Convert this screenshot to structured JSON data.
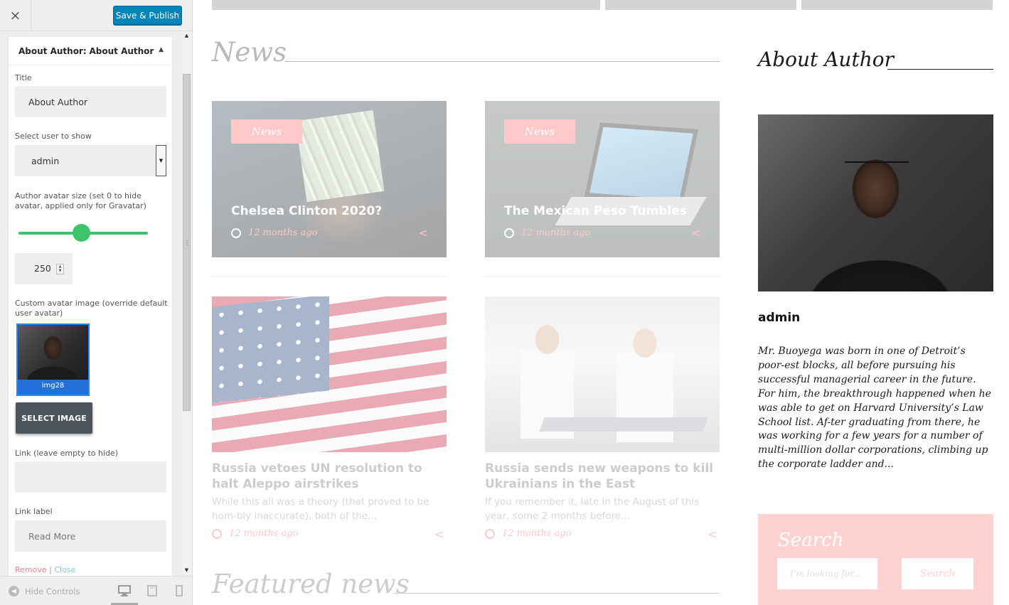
{
  "header": {
    "close_icon": "×",
    "save_label": "Save & Publish"
  },
  "widget": {
    "title_prefix": "About Author:",
    "title_instance": "About Author",
    "toggle_icon": "▲",
    "fields": {
      "title_label": "Title",
      "title_value": "About Author",
      "user_label": "Select user to show",
      "user_value": "admin",
      "avatar_size_label": "Author avatar size (set 0 to hide avatar, applied only for Gravatar)",
      "avatar_size_value": "250",
      "custom_avatar_label": "Custom avatar image (override default user avatar)",
      "avatar_file_name": "img28",
      "select_image_label": "SELECT IMAGE",
      "link_label": "Link (leave empty to hide)",
      "link_value": "",
      "link_label_label": "Link label",
      "link_label_value": "Read More"
    },
    "actions": {
      "remove": "Remove",
      "separator": "|",
      "close": "Close"
    }
  },
  "footer": {
    "hide_controls": "Hide Controls"
  },
  "preview": {
    "news_heading": "News",
    "featured_heading": "Featured news",
    "featured_cards": [
      {
        "badge": "News",
        "title": "Chelsea Clinton 2020?",
        "time": "12 months ago"
      },
      {
        "badge": "News",
        "title": "The Mexican Peso Tumbles",
        "time": "12 months ago"
      }
    ],
    "posts": [
      {
        "title": "Russia vetoes UN resolution to halt Aleppo airstrikes",
        "excerpt": "While this all was a theory (that proved to be hom-bly inaccurate), both of the...",
        "time": "12 months ago"
      },
      {
        "title": "Russia sends new weapons to kill Ukrainians in the East",
        "excerpt": "If you remember it, late in the August of this year, some 2 months before...",
        "time": "12 months ago"
      }
    ],
    "sidebar": {
      "about_heading": "About Author",
      "author_name": "admin",
      "author_bio": "Mr. Buoyega was born in one of Detroit’s poor-est blocks, all before pursuing his successful managerial career in the future. For him, the breakthrough happened when he was able to get on Harvard University’s Law School list. Af-ter graduating from there, he was working for a few years for a number of multi-million dollar corporations, climbing up the corporate ladder and...",
      "search_title": "Search",
      "search_placeholder": "I’m looking for...",
      "search_button": "Search"
    }
  },
  "colors": {
    "publish_blue": "#0085ba",
    "slider_green": "#3cc46a",
    "accent_red": "#ff6f6f",
    "select_image_btn": "#4d555c"
  },
  "icons": {
    "close": "close-icon",
    "toggle": "triangle-up-icon",
    "clock": "clock-icon",
    "share": "share-icon",
    "hide_controls": "arrow-left-circle-icon",
    "devices": [
      "desktop-icon",
      "tablet-icon",
      "mobile-icon"
    ]
  }
}
